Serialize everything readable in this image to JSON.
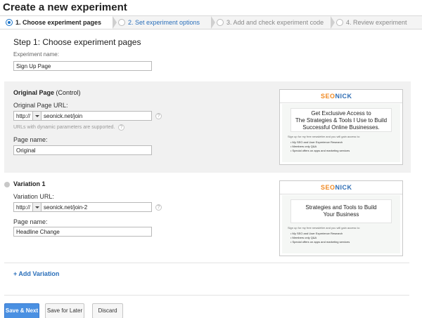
{
  "page_title": "Create a new experiment",
  "wizard": {
    "steps": [
      {
        "label": "1. Choose experiment pages"
      },
      {
        "label": "2. Set experiment options"
      },
      {
        "label": "3. Add and check experiment code"
      },
      {
        "label": "4. Review experiment"
      }
    ]
  },
  "step_heading": "Step 1: Choose experiment pages",
  "experiment_name": {
    "label": "Experiment name:",
    "value": "Sign Up Page"
  },
  "original": {
    "title": "Original Page",
    "subtitle": "(Control)",
    "url_label": "Original Page URL:",
    "protocol": "http://",
    "url": "seonick.net/join",
    "hint": "URLs with dynamic parameters are supported.",
    "name_label": "Page name:",
    "name_value": "Original",
    "preview": {
      "logo_a": "SEO",
      "logo_b": "NICK",
      "headline_1": "Get Exclusive Access to",
      "headline_2": "The Strategies & Tools I Use to Build",
      "headline_3": "Successful Online Businesses.",
      "small": "Sign up for my free newsletter and you will gain access to:",
      "bullet_1": "• My SEO and User Experience Research",
      "bullet_2": "• Members only Q&A",
      "bullet_3": "• Special offers on apps and marketing services"
    }
  },
  "variation": {
    "title": "Variation 1",
    "url_label": "Variation URL:",
    "protocol": "http://",
    "url": "seonick.net/join-2",
    "name_label": "Page name:",
    "name_value": "Headline Change",
    "preview": {
      "logo_a": "SEO",
      "logo_b": "NICK",
      "headline_1": "Strategies and Tools to Build",
      "headline_2": "Your Business",
      "small": "Sign up for my free newsletter and you will gain access to:",
      "bullet_1": "• My SEO and User Experience Research",
      "bullet_2": "• Members only Q&A",
      "bullet_3": "• Special offers on apps and marketing services"
    }
  },
  "add_variation": "+ Add Variation",
  "buttons": {
    "save_next": "Save & Next",
    "save_later": "Save for Later",
    "discard": "Discard"
  },
  "help_glyph": "?",
  "colors": {
    "accent": "#4a90e2",
    "link": "#2a6fba",
    "panel": "#f1f1f1"
  }
}
